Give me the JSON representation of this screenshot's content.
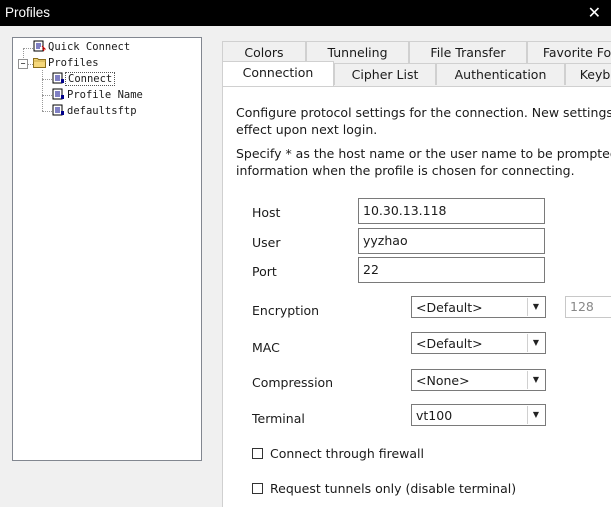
{
  "window": {
    "title": "Profiles",
    "close_glyph": "✕"
  },
  "tree": {
    "items": [
      {
        "label": "Quick Connect",
        "icon": "quick-connect-icon"
      },
      {
        "label": "Profiles",
        "icon": "folder-icon",
        "expander": "−"
      },
      {
        "label": "Connect",
        "icon": "profile-icon"
      },
      {
        "label": "Profile Name",
        "icon": "profile-icon"
      },
      {
        "label": "defaultsftp",
        "icon": "profile-icon"
      }
    ]
  },
  "tabs": {
    "back_row": [
      "Colors",
      "Tunneling",
      "File Transfer",
      "Favorite Fo"
    ],
    "front_row": [
      "Connection",
      "Cipher List",
      "Authentication",
      "Keyb"
    ],
    "active": "Connection"
  },
  "connection": {
    "desc1_line1": "Configure protocol settings for the connection. New settings will",
    "desc1_line2": "effect upon next login.",
    "desc2_line1": "Specify * as the host name or the user name to be prompted for",
    "desc2_line2": "information when the profile is chosen for connecting.",
    "host_label": "Host",
    "host_value": "10.30.13.118",
    "user_label": "User",
    "user_value": "yyzhao",
    "port_label": "Port",
    "port_value": "22",
    "encryption_label": "Encryption",
    "encryption_value": "<Default>",
    "encryption_bits": "128",
    "mac_label": "MAC",
    "mac_value": "<Default>",
    "compression_label": "Compression",
    "compression_value": "<None>",
    "terminal_label": "Terminal",
    "terminal_value": "vt100",
    "firewall_label": "Connect through firewall",
    "tunnels_label": "Request tunnels only (disable terminal)",
    "dropdown_arrow": "▼"
  }
}
